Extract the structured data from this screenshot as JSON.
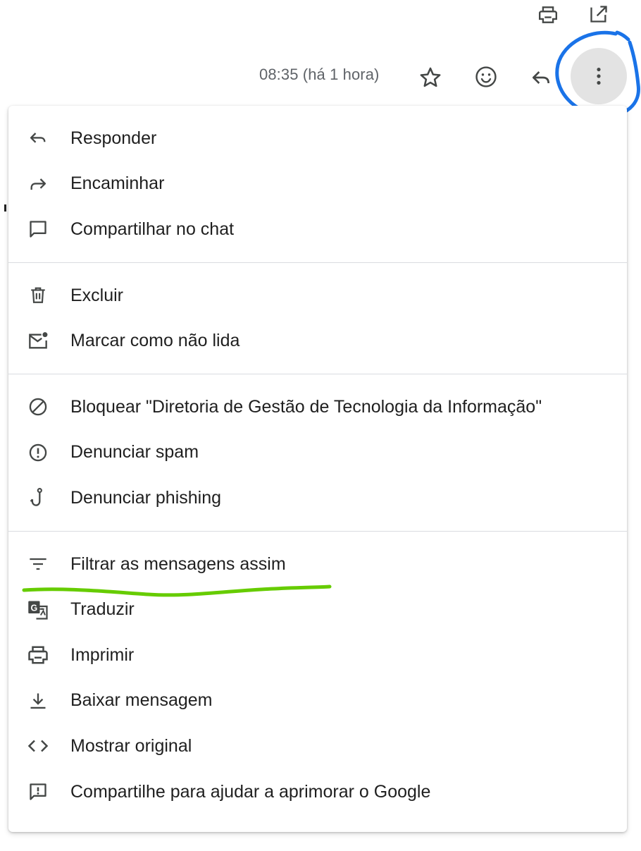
{
  "header": {
    "timestamp": "08:35 (há 1 hora)",
    "icons": [
      "print-icon",
      "open-in-new-window-icon",
      "star-icon",
      "emoji-icon",
      "reply-icon",
      "more-vert-icon"
    ]
  },
  "menu": {
    "groups": [
      {
        "items": [
          {
            "label": "Responder",
            "icon": "reply-icon"
          },
          {
            "label": "Encaminhar",
            "icon": "forward-icon"
          },
          {
            "label": "Compartilhar no chat",
            "icon": "chat-bubble-icon"
          }
        ]
      },
      {
        "items": [
          {
            "label": "Excluir",
            "icon": "trash-icon"
          },
          {
            "label": "Marcar como não lida",
            "icon": "mark-unread-icon"
          }
        ]
      },
      {
        "items": [
          {
            "label": "Bloquear \"Diretoria de Gestão de Tecnologia da Informação\"",
            "icon": "block-icon"
          },
          {
            "label": "Denunciar spam",
            "icon": "report-spam-icon"
          },
          {
            "label": "Denunciar phishing",
            "icon": "phishing-hook-icon"
          }
        ]
      },
      {
        "items": [
          {
            "label": "Filtrar as mensagens assim",
            "icon": "filter-icon"
          },
          {
            "label": "Traduzir",
            "icon": "translate-icon"
          },
          {
            "label": "Imprimir",
            "icon": "print-icon"
          },
          {
            "label": "Baixar mensagem",
            "icon": "download-icon"
          },
          {
            "label": "Mostrar original",
            "icon": "code-icon"
          },
          {
            "label": "Compartilhe para ajudar a aprimorar o Google",
            "icon": "feedback-icon"
          }
        ]
      }
    ]
  },
  "colors": {
    "annotation_circle": "#1a73e8",
    "annotation_underline": "#66cc00",
    "icon": "#444746",
    "text": "#1f1f1f",
    "muted_text": "#5f6368",
    "more_button_bg": "#e3e3e3"
  }
}
